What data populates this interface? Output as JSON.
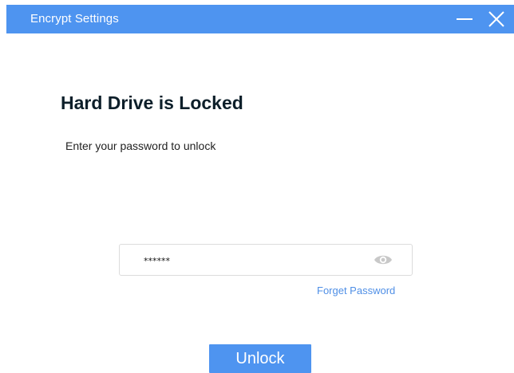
{
  "window": {
    "title": "Encrypt Settings",
    "minimize_icon": "minimize-icon",
    "close_icon": "close-icon"
  },
  "main": {
    "heading": "Hard Drive is Locked",
    "subtext": "Enter your password to unlock",
    "password": {
      "value": "******",
      "toggle_icon": "eye-icon"
    },
    "forget_link": "Forget Password",
    "unlock_label": "Unlock"
  },
  "colors": {
    "accent": "#4e94f0",
    "link": "#4f8fe6",
    "heading": "#0d1f2a"
  }
}
